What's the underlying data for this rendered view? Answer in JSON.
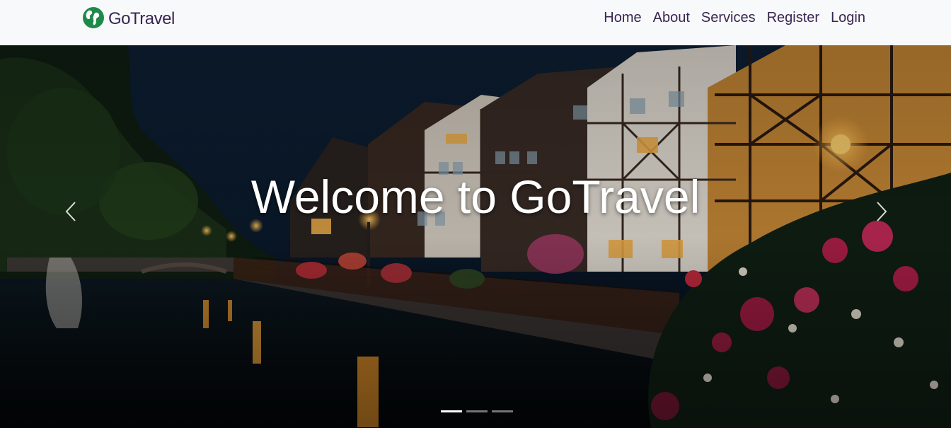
{
  "brand": {
    "name": "GoTravel",
    "icon": "globe-icon",
    "color": "#1e8a4a"
  },
  "nav": {
    "items": [
      {
        "label": "Home"
      },
      {
        "label": "About"
      },
      {
        "label": "Services"
      },
      {
        "label": "Register"
      },
      {
        "label": "Login"
      }
    ]
  },
  "hero": {
    "title": "Welcome to GoTravel",
    "prev_icon": "chevron-left-icon",
    "next_icon": "chevron-right-icon",
    "slides_total": 3,
    "active_slide": 1
  },
  "colors": {
    "nav_bg": "#f8f9fb",
    "nav_text": "#3a2550",
    "hero_text": "#ffffff"
  }
}
